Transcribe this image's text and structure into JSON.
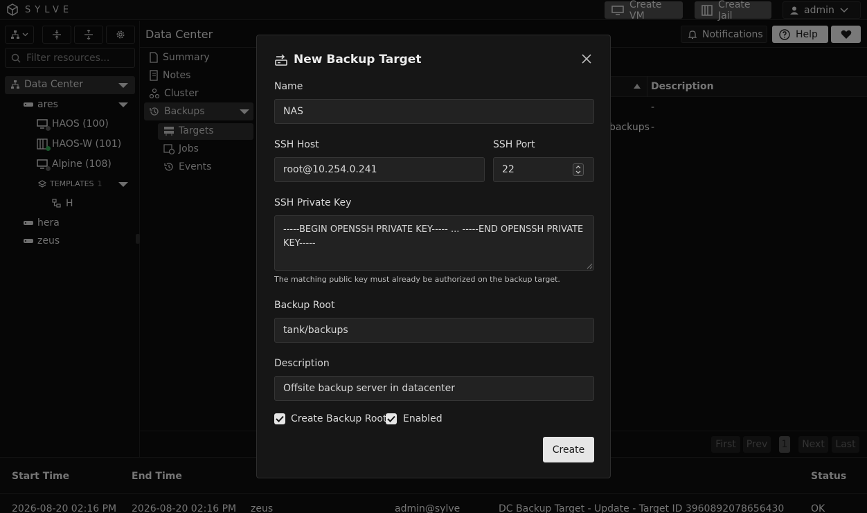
{
  "app": {
    "brand": "SYLVE"
  },
  "topbar": {
    "create_vm": "Create VM",
    "create_jail": "Create Jail",
    "user": "admin"
  },
  "header": {
    "title": "Data Center",
    "notifications": "Notifications",
    "help": "Help"
  },
  "sidebar": {
    "filter_placeholder": "Filter resources...",
    "root": "Data Center",
    "nodes": [
      {
        "label": "ares",
        "children": [
          "HAOS (100)",
          "HAOS-W (101)",
          "Alpine (108)"
        ]
      },
      {
        "label": "hera"
      },
      {
        "label": "zeus"
      }
    ],
    "templates": {
      "label": "TEMPLATES",
      "count": "1",
      "items": [
        "H"
      ]
    }
  },
  "nav": {
    "items": [
      "Summary",
      "Notes",
      "Cluster",
      "Backups"
    ],
    "sub_items": [
      "Targets",
      "Jobs",
      "Events"
    ]
  },
  "table": {
    "description_header": "Description",
    "rows": [
      {
        "desc": "-"
      },
      {
        "frag": "backups",
        "desc": "-"
      }
    ]
  },
  "pagination": {
    "first": "First",
    "prev": "Prev",
    "page": "1",
    "next": "Next",
    "last": "Last"
  },
  "bottom": {
    "headers": [
      "Start Time",
      "End Time",
      "Status"
    ],
    "row": {
      "start": "2026-08-20 02:16 PM",
      "end": "2026-08-20 02:16 PM",
      "node": "zeus",
      "user": "admin@sylve",
      "action": "DC Backup Target - Update - Target ID 3960892078656430",
      "status": "OK"
    }
  },
  "modal": {
    "title": "New Backup Target",
    "name_label": "Name",
    "name_value": "NAS",
    "host_label": "SSH Host",
    "host_value": "root@10.254.0.241",
    "port_label": "SSH Port",
    "port_value": "22",
    "key_label": "SSH Private Key",
    "key_value": "-----BEGIN OPENSSH PRIVATE KEY----- ... -----END OPENSSH PRIVATE KEY-----",
    "key_hint": "The matching public key must already be authorized on the backup target.",
    "root_label": "Backup Root",
    "root_value": "tank/backups",
    "desc_label": "Description",
    "desc_value": "Offsite backup server in datacenter",
    "create_root_label": "Create Backup Root",
    "create_root_checked": true,
    "enabled_label": "Enabled",
    "enabled_checked": true,
    "create_button": "Create"
  },
  "colors": {
    "accent_green": "#2e9e4f",
    "button_light": "#4a4a4a",
    "modal_bg": "#161616"
  }
}
